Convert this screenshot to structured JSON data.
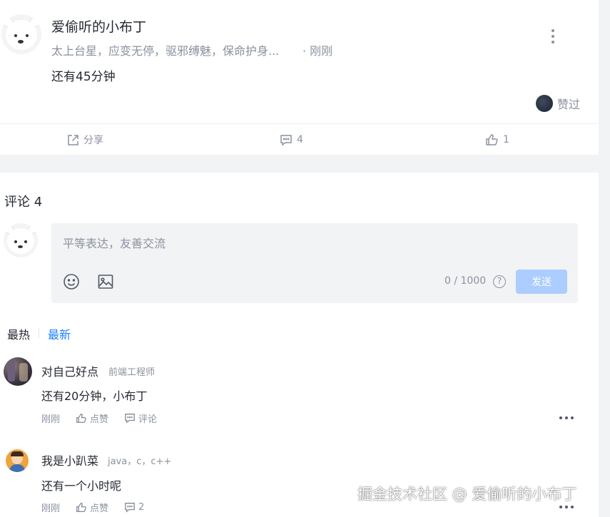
{
  "post": {
    "author": "爱偷听的小布丁",
    "tagline": "太上台星，应变无停，驱邪缚魅，保命护身...",
    "time": "· 刚刚",
    "content": "还有45分钟",
    "liked_label": "赞过",
    "actions": {
      "share": "分享",
      "comments": "4",
      "likes": "1"
    }
  },
  "comments": {
    "title": "评论 4",
    "editor": {
      "placeholder": "平等表达，友善交流",
      "count": "0 / 1000",
      "help": "?",
      "send": "发送"
    },
    "sort": {
      "hot": "最热",
      "new": "最新"
    },
    "items": [
      {
        "name": "对自己好点",
        "title": "前端工程师",
        "text": "还有20分钟，小布丁",
        "time": "刚刚",
        "like": "点赞",
        "reply": "评论"
      },
      {
        "name": "我是小趴菜",
        "title": "java，c，c++",
        "text": "还有一个小时呢",
        "time": "刚刚",
        "like": "点赞",
        "reply": "2"
      }
    ]
  },
  "watermark": "掘金技术社区 @ 爱偷听的小布丁",
  "colors": {
    "accent": "#1e80ff",
    "muted": "#8a919f",
    "send_disabled": "#abcdff",
    "text": "#252933"
  },
  "icons": [
    "more-vertical-icon",
    "share-icon",
    "comment-icon",
    "like-icon",
    "emoji-icon",
    "image-icon",
    "help-icon",
    "more-horizontal-icon"
  ]
}
